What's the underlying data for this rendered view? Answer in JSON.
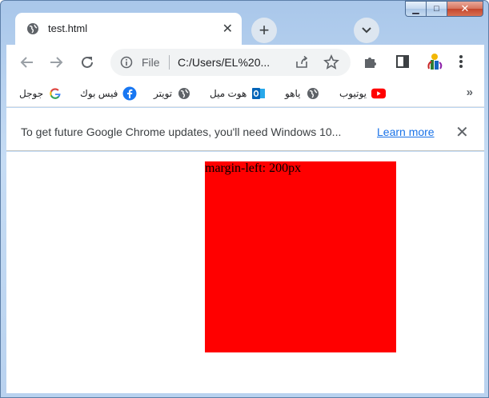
{
  "window": {
    "minimize_label": "▁",
    "maximize_label": "□",
    "close_label": "✕"
  },
  "tab": {
    "title": "test.html",
    "close_label": "✕"
  },
  "new_tab_label": "+",
  "omnibox": {
    "scheme": "File",
    "url": "C:/Users/EL%20..."
  },
  "bookmarks": [
    {
      "label": "جوجل",
      "icon": "google-icon"
    },
    {
      "label": "فيس بوك",
      "icon": "facebook-icon"
    },
    {
      "label": "تويتر",
      "icon": "globe-icon"
    },
    {
      "label": "هوت ميل",
      "icon": "outlook-icon"
    },
    {
      "label": "ياهو",
      "icon": "globe-icon"
    },
    {
      "label": "يوتيوب",
      "icon": "youtube-icon"
    }
  ],
  "bookmarks_more": "»",
  "infobar": {
    "message": "To get future Google Chrome updates, you'll need Windows 10...",
    "link": "Learn more",
    "dismiss": "✕"
  },
  "content": {
    "box_text": "margin-left: 200px",
    "box_color": "#ff0000"
  }
}
